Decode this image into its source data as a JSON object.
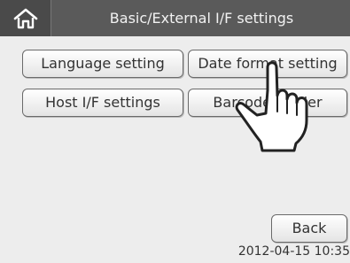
{
  "title_bar": {
    "home_icon": "home-icon",
    "title": "Basic/External I/F settings"
  },
  "menu": {
    "language_setting": "Language setting",
    "date_format_setting": "Date format setting",
    "host_if_settings": "Host I/F settings",
    "barcode_reader": "Barcode reader"
  },
  "footer": {
    "back_label": "Back",
    "timestamp": "2012-04-15 10:35"
  },
  "overlay": {
    "pointer_icon": "pointing-hand-icon"
  }
}
